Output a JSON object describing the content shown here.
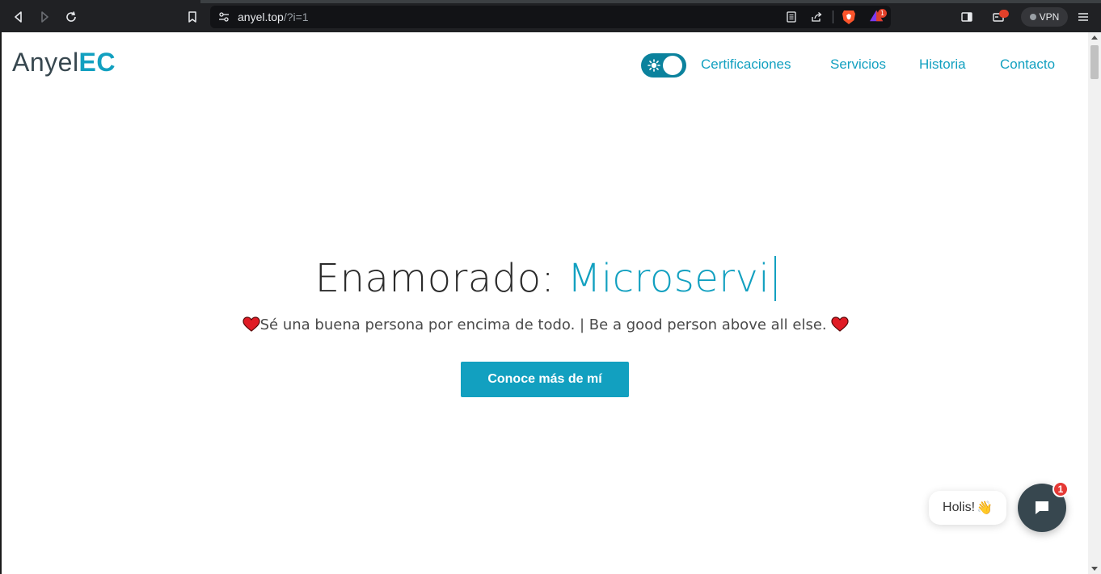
{
  "browser": {
    "url_host": "anyel.top",
    "url_rest": "/?i=1",
    "rewards_badge": "1",
    "vpn_label": "VPN"
  },
  "header": {
    "logo_main": "Anyel",
    "logo_accent": "EC",
    "nav": [
      {
        "label": "Certificaciones"
      },
      {
        "label": "Servicios"
      },
      {
        "label": "Historia"
      },
      {
        "label": "Contacto"
      }
    ]
  },
  "hero": {
    "title_static": "Enamorado:",
    "title_typed": "Microservi",
    "tagline": "Sé una buena persona por encima de todo. | Be a good person above all else.",
    "cta_label": "Conoce más de mí"
  },
  "chat": {
    "greeting": "Holis!",
    "greeting_emoji": "👋",
    "badge_count": "1"
  },
  "colors": {
    "accent": "#12a0c0",
    "toggle": "#0b829d",
    "chat_button": "#37474f",
    "badge": "#e53935"
  }
}
